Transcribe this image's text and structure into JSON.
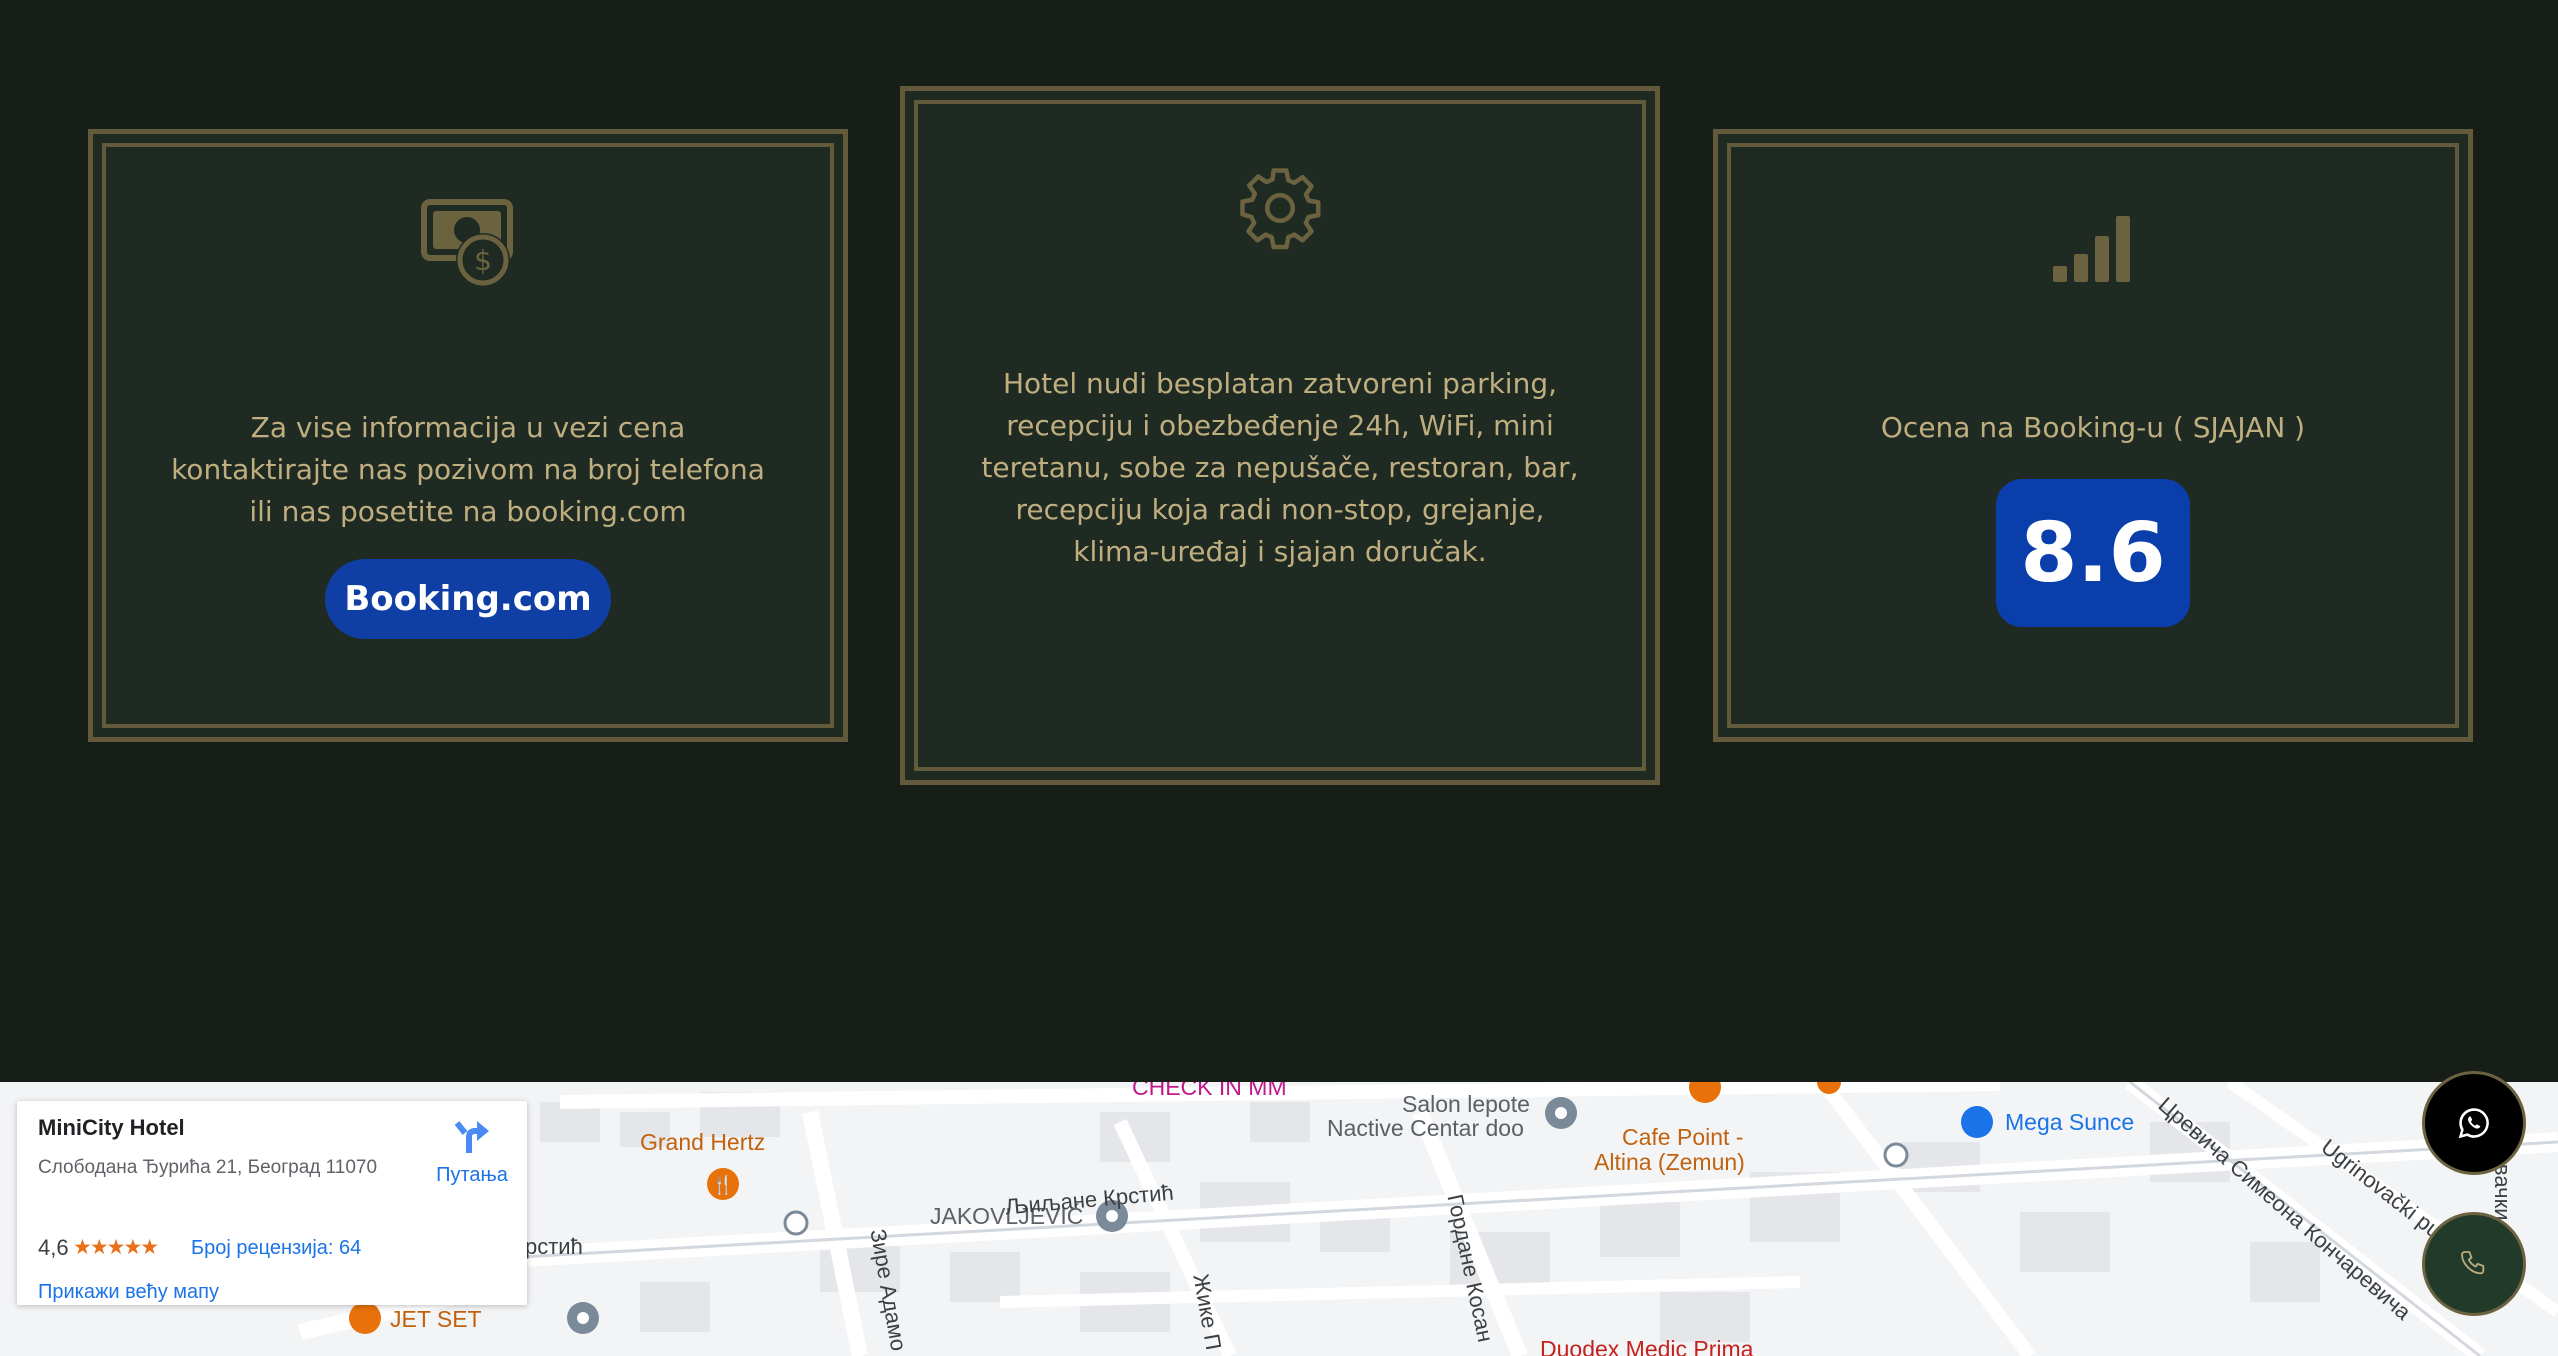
{
  "cards": {
    "prices": {
      "icon": "money-dollar-icon",
      "text": "Za vise informacija u vezi cena kontaktirajte nas pozivom na broj telefona ili nas posetite na booking.com",
      "button_label": "Booking.com"
    },
    "amenities": {
      "icon": "gear-icon",
      "text": "Hotel nudi besplatan zatvoreni parking, recepciju i obezbeđenje 24h, WiFi, mini teretanu, sobe za nepušače, restoran, bar, recepciju koja radi non-stop, grejanje, klima-uređaj i sjajan doručak."
    },
    "rating": {
      "icon": "signal-bars-icon",
      "text": "Ocena na Booking-u ( SJAJAN )",
      "score": "8.6"
    }
  },
  "map": {
    "place": {
      "name": "MiniCity Hotel",
      "address": "Слободана Ђурића 21, Београд 11070",
      "rating": "4,6",
      "stars": "★★★★★",
      "reviews_link": "Број рецензија: 64",
      "directions_label": "Путања",
      "larger_map_link": "Прикажи већу мапу"
    },
    "labels": {
      "check_in": "CHECK IN  MM",
      "grand_hertz": "Grand Hertz",
      "salon_1": "Salon lepote",
      "salon_2": "Nactive Centar doo",
      "cafe_1": "Cafe Point -",
      "cafe_2": "Altina (Zemun)",
      "mega_sunce": "Mega Sunce",
      "ugrinovacki": "Ugrinovački put",
      "jakovljevic": "JAKOVLJEVIĆ",
      "ljiljane": "Љиљане Крстић",
      "krstic": "рстић",
      "zire": "Зире Адамо",
      "zike": "Жике П",
      "gordane": "Гордане Косан",
      "simeona": "Цревича Симеона Кончаревича",
      "ugrinovacki_2": "Угриновачки пут",
      "jet_set": "JET SET",
      "duodex": "Duodex Medic Prima"
    }
  },
  "colors": {
    "background": "#161e17",
    "card": "#1f2a22",
    "border_gold": "#635a3b",
    "text_gold": "#bfae7f",
    "booking_blue": "#0f3fa4"
  },
  "fabs": {
    "whatsapp_icon": "whatsapp-icon",
    "phone_icon": "phone-icon"
  }
}
